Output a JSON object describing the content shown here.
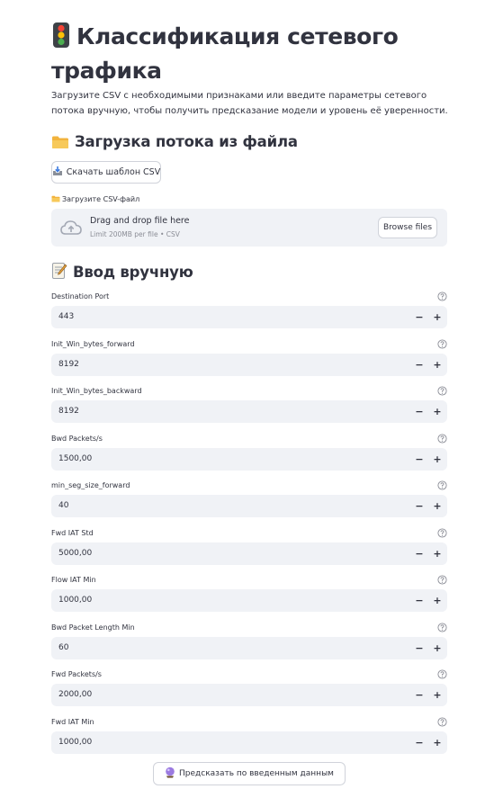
{
  "header": {
    "title_icon": "traffic-light-icon",
    "title": "Классификация сетевого трафика",
    "description": "Загрузите CSV с необходимыми признаками или введите параметры сетевого потока вручную, чтобы получить предсказание модели и уровень её уверенности."
  },
  "file_section": {
    "icon": "folder-icon",
    "title": "Загрузка потока из файла",
    "download_button_icon": "inbox-tray-icon",
    "download_button": "Скачать шаблон CSV",
    "uploader_icon": "folder-icon",
    "uploader_label": "Загрузите CSV-файл",
    "dropzone_icon": "cloud-upload-icon",
    "dropzone_text": "Drag and drop file here",
    "dropzone_hint": "Limit 200MB per file • CSV",
    "browse_button": "Browse files"
  },
  "manual_section": {
    "icon": "memo-icon",
    "title": "Ввод вручную",
    "fields": [
      {
        "label": "Destination Port",
        "value": "443"
      },
      {
        "label": "Init_Win_bytes_forward",
        "value": "8192"
      },
      {
        "label": "Init_Win_bytes_backward",
        "value": "8192"
      },
      {
        "label": "Bwd Packets/s",
        "value": "1500,00"
      },
      {
        "label": "min_seg_size_forward",
        "value": "40"
      },
      {
        "label": "Fwd IAT Std",
        "value": "5000,00"
      },
      {
        "label": "Flow IAT Min",
        "value": "1000,00"
      },
      {
        "label": "Bwd Packet Length Min",
        "value": "60"
      },
      {
        "label": "Fwd Packets/s",
        "value": "2000,00"
      },
      {
        "label": "Fwd IAT Min",
        "value": "1000,00"
      }
    ],
    "minus_symbol": "−",
    "plus_symbol": "+",
    "help_icon": "help-circle-icon",
    "predict_button_icon": "crystal-ball-icon",
    "predict_button": "Предсказать по введенным данным"
  },
  "colors": {
    "text": "#31333f",
    "muted": "#8b8d96",
    "input_bg": "#f0f2f6",
    "border": "#d0d3da"
  }
}
